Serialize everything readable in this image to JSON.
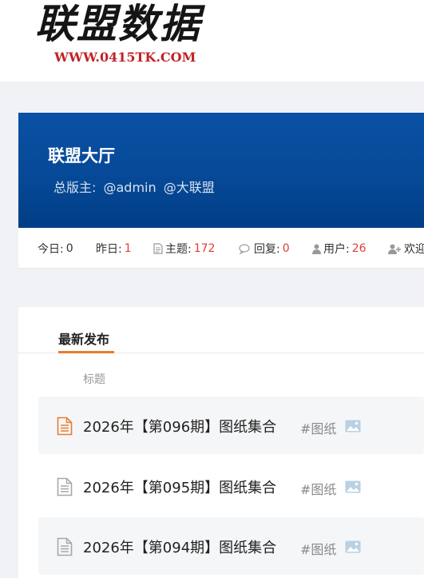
{
  "logo": {
    "title": "联盟数据",
    "url": "WWW.0415TK.COM"
  },
  "forum": {
    "name": "联盟大厅",
    "moderators_label": "总版主:",
    "moderators": [
      "@admin",
      "@大联盟"
    ]
  },
  "stats": {
    "today_label": "今日:",
    "today": "0",
    "yesterday_label": "昨日:",
    "yesterday": "1",
    "topics_label": "主题:",
    "topics": "172",
    "replies_label": "回复:",
    "replies": "0",
    "users_label": "用户:",
    "users": "26",
    "welcome_label": "欢迎"
  },
  "tabs": {
    "active": "最新发布"
  },
  "list": {
    "column_title": "标题",
    "threads": [
      {
        "title": "2026年【第096期】图纸集合",
        "tag": "#图纸",
        "icon": "file-icon-orange"
      },
      {
        "title": "2026年【第095期】图纸集合",
        "tag": "#图纸",
        "icon": "file-icon-gray"
      },
      {
        "title": "2026年【第094期】图纸集合",
        "tag": "#图纸",
        "icon": "file-icon-gray"
      }
    ]
  },
  "colors": {
    "accent": "#e87c2e",
    "banner": "#064896",
    "count": "#e53b3b"
  }
}
